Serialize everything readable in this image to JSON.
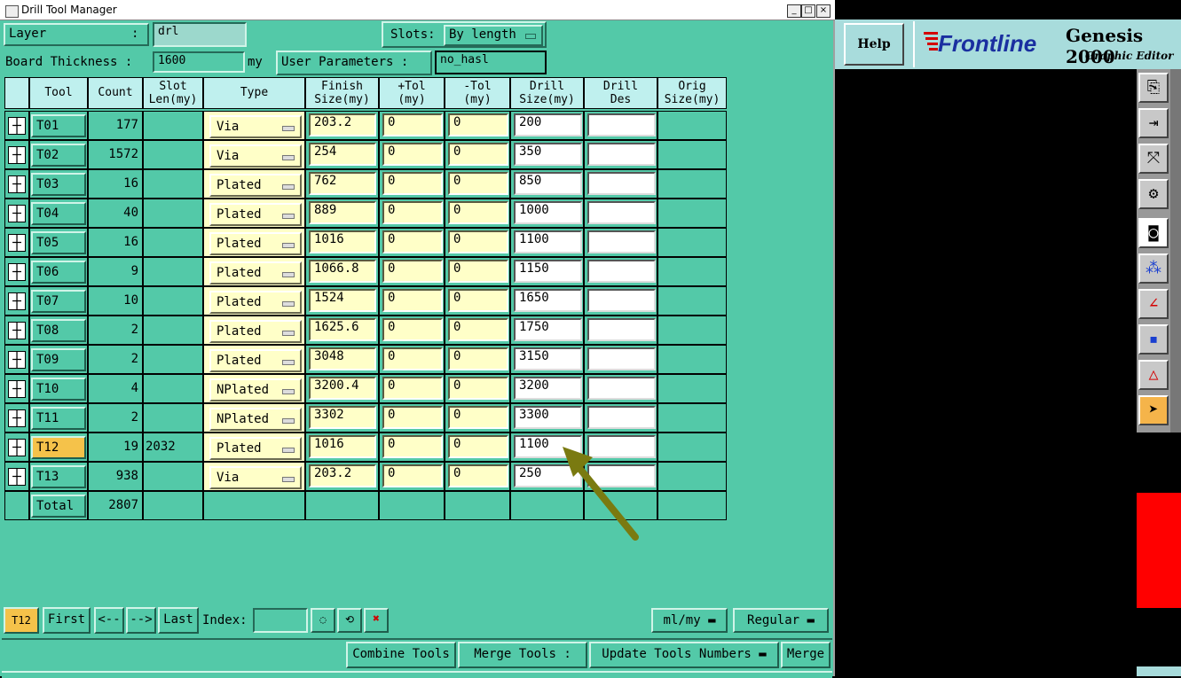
{
  "window": {
    "title": "Drill Tool Manager"
  },
  "top": {
    "layer_label": "Layer",
    "layer_colon": ":",
    "layer_value": "drl",
    "slots_label": "Slots:",
    "slots_value": "By length",
    "thickness_label": "Board Thickness :",
    "thickness_value": "1600",
    "thickness_unit": "my",
    "user_params_label": "User Parameters :",
    "user_params_value": "no_hasl"
  },
  "headers": {
    "tool": "Tool",
    "count": "Count",
    "slot1": "Slot",
    "slot2": "Len(my)",
    "type": "Type",
    "finish1": "Finish",
    "finish2": "Size(my)",
    "ptol1": "+Tol",
    "ptol2": "(my)",
    "mtol1": "-Tol",
    "mtol2": "(my)",
    "drill1": "Drill",
    "drill2": "Size(my)",
    "des1": "Drill",
    "des2": "Des",
    "orig1": "Orig",
    "orig2": "Size(my)"
  },
  "rows": [
    {
      "tool": "T01",
      "count": "177",
      "slot": "",
      "type": "Via",
      "finish": "203.2",
      "ptol": "0",
      "mtol": "0",
      "drill": "200",
      "des": ""
    },
    {
      "tool": "T02",
      "count": "1572",
      "slot": "",
      "type": "Via",
      "finish": "254",
      "ptol": "0",
      "mtol": "0",
      "drill": "350",
      "des": ""
    },
    {
      "tool": "T03",
      "count": "16",
      "slot": "",
      "type": "Plated",
      "finish": "762",
      "ptol": "0",
      "mtol": "0",
      "drill": "850",
      "des": ""
    },
    {
      "tool": "T04",
      "count": "40",
      "slot": "",
      "type": "Plated",
      "finish": "889",
      "ptol": "0",
      "mtol": "0",
      "drill": "1000",
      "des": ""
    },
    {
      "tool": "T05",
      "count": "16",
      "slot": "",
      "type": "Plated",
      "finish": "1016",
      "ptol": "0",
      "mtol": "0",
      "drill": "1100",
      "des": ""
    },
    {
      "tool": "T06",
      "count": "9",
      "slot": "",
      "type": "Plated",
      "finish": "1066.8",
      "ptol": "0",
      "mtol": "0",
      "drill": "1150",
      "des": ""
    },
    {
      "tool": "T07",
      "count": "10",
      "slot": "",
      "type": "Plated",
      "finish": "1524",
      "ptol": "0",
      "mtol": "0",
      "drill": "1650",
      "des": ""
    },
    {
      "tool": "T08",
      "count": "2",
      "slot": "",
      "type": "Plated",
      "finish": "1625.6",
      "ptol": "0",
      "mtol": "0",
      "drill": "1750",
      "des": ""
    },
    {
      "tool": "T09",
      "count": "2",
      "slot": "",
      "type": "Plated",
      "finish": "3048",
      "ptol": "0",
      "mtol": "0",
      "drill": "3150",
      "des": ""
    },
    {
      "tool": "T10",
      "count": "4",
      "slot": "",
      "type": "NPlated",
      "finish": "3200.4",
      "ptol": "0",
      "mtol": "0",
      "drill": "3200",
      "des": ""
    },
    {
      "tool": "T11",
      "count": "2",
      "slot": "",
      "type": "NPlated",
      "finish": "3302",
      "ptol": "0",
      "mtol": "0",
      "drill": "3300",
      "des": ""
    },
    {
      "tool": "T12",
      "count": "19",
      "slot": "2032",
      "type": "Plated",
      "finish": "1016",
      "ptol": "0",
      "mtol": "0",
      "drill": "1100",
      "des": "",
      "selected": true
    },
    {
      "tool": "T13",
      "count": "938",
      "slot": "",
      "type": "Via",
      "finish": "203.2",
      "ptol": "0",
      "mtol": "0",
      "drill": "250",
      "des": ""
    }
  ],
  "total": {
    "label": "Total",
    "count": "2807"
  },
  "bottom": {
    "current_tool": "T12",
    "first": "First",
    "prev": "<--",
    "next": "-->",
    "last": "Last",
    "index_label": "Index:",
    "index_value": "",
    "units": "ml/my",
    "mode": "Regular",
    "combine": "Combine Tools",
    "merge_label": "Merge Tools :",
    "update": "Update Tools Numbers",
    "merge": "Merge"
  },
  "right_panel": {
    "help": "Help",
    "brand": "Frontline",
    "product": "Genesis 2000",
    "subtitle": "Graphic Editor"
  },
  "colors": {
    "panel": "#53c9a8",
    "header": "#bff0ee",
    "field": "#ffffc8",
    "selected": "#f5c24a",
    "arrow": "#7a7a10"
  }
}
